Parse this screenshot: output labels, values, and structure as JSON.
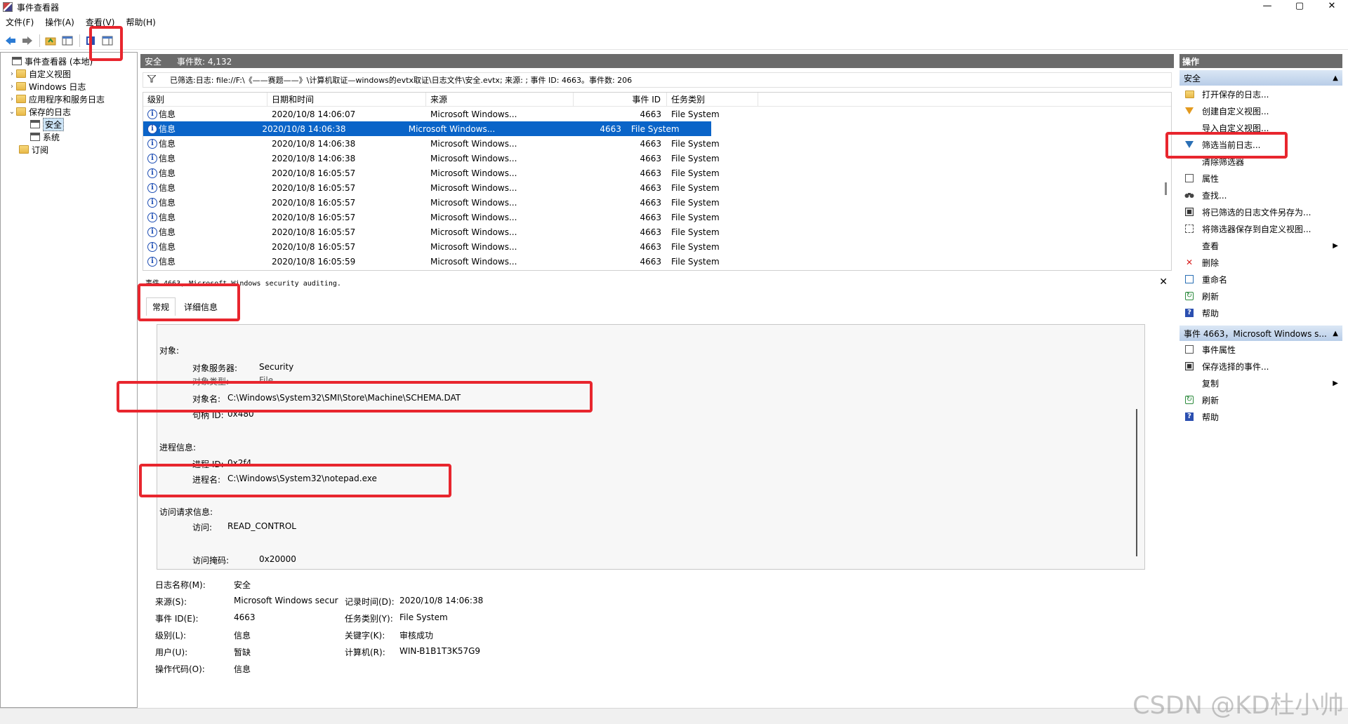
{
  "window": {
    "title": "事件查看器",
    "controls": [
      "—",
      "▢",
      "✕"
    ]
  },
  "menubar": [
    "文件(F)",
    "操作(A)",
    "查看(V)",
    "帮助(H)"
  ],
  "tree": [
    {
      "label": "事件查看器 (本地)",
      "expander": "",
      "icon": "log"
    },
    {
      "label": "自定义视图",
      "expander": "›",
      "icon": "folder"
    },
    {
      "label": "Windows 日志",
      "expander": "›",
      "icon": "folder"
    },
    {
      "label": "应用程序和服务日志",
      "expander": "›",
      "icon": "folder"
    },
    {
      "label": "保存的日志",
      "expander": "⌄",
      "icon": "folder"
    },
    {
      "label": "安全",
      "expander": "",
      "icon": "log",
      "selected": true
    },
    {
      "label": "系统",
      "expander": "",
      "icon": "log"
    },
    {
      "label": "订阅",
      "expander": "",
      "icon": "folder"
    }
  ],
  "center": {
    "title": "安全",
    "count": "事件数: 4,132",
    "filter": "已筛选:日志: file://F:\\《——赛题——》\\计算机取证—windows的evtx取证\\日志文件\\安全.evtx; 来源: ; 事件 ID: 4663。事件数: 206"
  },
  "table": {
    "headers": [
      "级别",
      "日期和时间",
      "来源",
      "事件 ID",
      "任务类别"
    ],
    "rows": [
      {
        "level": "信息",
        "date": "2020/10/8 14:06:07",
        "source": "Microsoft Windows...",
        "id": "4663",
        "category": "File System"
      },
      {
        "level": "信息",
        "date": "2020/10/8 14:06:38",
        "source": "Microsoft Windows...",
        "id": "4663",
        "category": "File System"
      },
      {
        "level": "信息",
        "date": "2020/10/8 14:06:38",
        "source": "Microsoft Windows...",
        "id": "4663",
        "category": "File System"
      },
      {
        "level": "信息",
        "date": "2020/10/8 14:06:38",
        "source": "Microsoft Windows...",
        "id": "4663",
        "category": "File System"
      },
      {
        "level": "信息",
        "date": "2020/10/8 16:05:57",
        "source": "Microsoft Windows...",
        "id": "4663",
        "category": "File System"
      },
      {
        "level": "信息",
        "date": "2020/10/8 16:05:57",
        "source": "Microsoft Windows...",
        "id": "4663",
        "category": "File System"
      },
      {
        "level": "信息",
        "date": "2020/10/8 16:05:57",
        "source": "Microsoft Windows...",
        "id": "4663",
        "category": "File System"
      },
      {
        "level": "信息",
        "date": "2020/10/8 16:05:57",
        "source": "Microsoft Windows...",
        "id": "4663",
        "category": "File System"
      },
      {
        "level": "信息",
        "date": "2020/10/8 16:05:57",
        "source": "Microsoft Windows...",
        "id": "4663",
        "category": "File System"
      },
      {
        "level": "信息",
        "date": "2020/10/8 16:05:57",
        "source": "Microsoft Windows...",
        "id": "4663",
        "category": "File System"
      },
      {
        "level": "信息",
        "date": "2020/10/8 16:05:59",
        "source": "Microsoft Windows...",
        "id": "4663",
        "category": "File System"
      }
    ]
  },
  "detail": {
    "header": "事件 4663, Microsoft Windows security auditing.",
    "tabs": [
      "常规",
      "详细信息"
    ],
    "object_heading": "对象:",
    "object_server_label": "对象服务器:",
    "object_server_value": "Security",
    "object_type_label": "对象类型:",
    "object_type_value": "File",
    "object_name_label": "对象名:",
    "object_name_value": "C:\\Windows\\System32\\SMI\\Store\\Machine\\SCHEMA.DAT",
    "handle_label": "句柄 ID:",
    "handle_value": "0x480",
    "process_heading": "进程信息:",
    "process_id_label": "进程 ID:",
    "process_id_value": "0x2f4",
    "process_name_label": "进程名:",
    "process_name_value": "C:\\Windows\\System32\\notepad.exe",
    "access_heading": "访问请求信息:",
    "access_label": "访问:",
    "access_value": "READ_CONTROL",
    "mask_label": "访问掩码:",
    "mask_value": "0x20000"
  },
  "properties": {
    "log_name_label": "日志名称(M):",
    "log_name_value": "安全",
    "source_label": "来源(S):",
    "source_value": "Microsoft Windows secur",
    "logged_label": "记录时间(D):",
    "logged_value": "2020/10/8 14:06:38",
    "event_id_label": "事件 ID(E):",
    "event_id_value": "4663",
    "task_label": "任务类别(Y):",
    "task_value": "File System",
    "level_label": "级别(L):",
    "level_value": "信息",
    "keywords_label": "关键字(K):",
    "keywords_value": "审核成功",
    "user_label": "用户(U):",
    "user_value": "暂缺",
    "computer_label": "计算机(R):",
    "computer_value": "WIN-B1B1T3K57G9",
    "opcode_label": "操作代码(O):",
    "opcode_value": "信息"
  },
  "actions": {
    "title": "操作",
    "section1": "安全",
    "items1": [
      "打开保存的日志...",
      "创建自定义视图...",
      "导入自定义视图...",
      "筛选当前日志...",
      "清除筛选器",
      "属性",
      "查找...",
      "将已筛选的日志文件另存为...",
      "将筛选器保存到自定义视图...",
      "查看",
      "删除",
      "重命名",
      "刷新",
      "帮助"
    ],
    "section2": "事件 4663，Microsoft Windows s...",
    "items2": [
      "事件属性",
      "保存选择的事件...",
      "复制",
      "刷新",
      "帮助"
    ]
  },
  "watermark": "CSDN @KD杜小帅"
}
